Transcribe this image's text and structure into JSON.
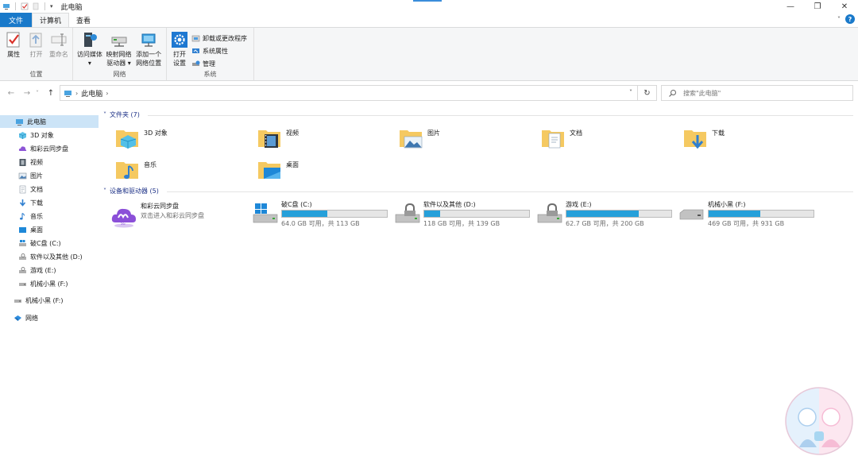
{
  "window": {
    "title": "此电脑",
    "minimize": "—",
    "maximize": "❐",
    "close": "✕"
  },
  "ribbon_tabs": [
    "文件",
    "计算机",
    "查看"
  ],
  "ribbon": {
    "location_group": {
      "label": "位置",
      "buttons": [
        "属性",
        "打开",
        "重命名"
      ]
    },
    "network_group": {
      "label": "网络",
      "access_media": [
        "访问媒体",
        "▾"
      ],
      "map_drive": [
        "映射网络",
        "驱动器 ▾"
      ],
      "add_location": [
        "添加一个",
        "网络位置"
      ]
    },
    "system_group": {
      "label": "系统",
      "open_settings": [
        "打开",
        "设置"
      ],
      "small": [
        "卸载或更改程序",
        "系统属性",
        "管理"
      ]
    }
  },
  "address": {
    "back": "←",
    "forward": "→",
    "recent": "˅",
    "up": "↑",
    "separator": "›",
    "path": "此电脑",
    "dropdown": "˅",
    "refresh": "↻",
    "search_placeholder": "搜索\"此电脑\""
  },
  "sidebar": {
    "items": [
      "此电脑",
      "3D 对象",
      "和彩云同步盘",
      "视频",
      "图片",
      "文档",
      "下载",
      "音乐",
      "桌面",
      "破C盘 (C:)",
      "软件以及其他 (D:)",
      "游戏 (E:)",
      "机械小黑 (F:)",
      "机械小黑 (F:)",
      "网络"
    ]
  },
  "folders_section": {
    "title": "文件夹 (7)",
    "chevron": "˅",
    "items": [
      "3D 对象",
      "视频",
      "图片",
      "文档",
      "下载",
      "音乐",
      "桌面"
    ]
  },
  "drives_section": {
    "title": "设备和驱动器 (5)",
    "chevron": "˅",
    "cloud": {
      "name": "和彩云同步盘",
      "subtitle": "双击进入和彩云同步盘"
    },
    "drives": [
      {
        "name": "破C盘 (C:)",
        "free": "64.0 GB 可用，共 113 GB",
        "used_fraction": 0.434
      },
      {
        "name": "软件以及其他 (D:)",
        "free": "118 GB 可用，共 139 GB",
        "used_fraction": 0.151
      },
      {
        "name": "游戏 (E:)",
        "free": "62.7 GB 可用，共 200 GB",
        "used_fraction": 0.687
      },
      {
        "name": "机械小黑 (F:)",
        "free": "469 GB 可用，共 931 GB",
        "used_fraction": 0.496
      }
    ]
  },
  "colors": {
    "accent": "#1979ca",
    "selection": "#cce4f7",
    "bar": "#26a0da",
    "section_header": "#1e3287"
  }
}
